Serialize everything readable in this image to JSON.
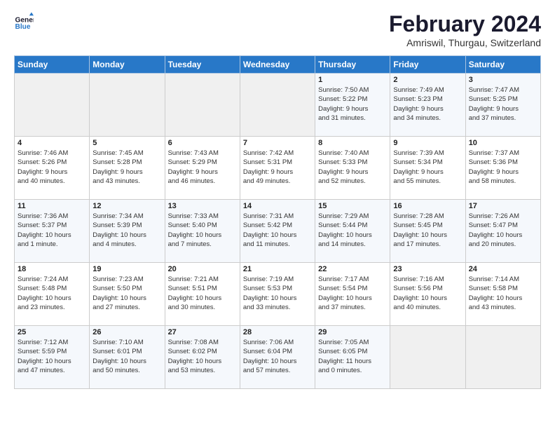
{
  "header": {
    "logo_line1": "General",
    "logo_line2": "Blue",
    "month_title": "February 2024",
    "subtitle": "Amriswil, Thurgau, Switzerland"
  },
  "days_of_week": [
    "Sunday",
    "Monday",
    "Tuesday",
    "Wednesday",
    "Thursday",
    "Friday",
    "Saturday"
  ],
  "weeks": [
    [
      {
        "num": "",
        "info": ""
      },
      {
        "num": "",
        "info": ""
      },
      {
        "num": "",
        "info": ""
      },
      {
        "num": "",
        "info": ""
      },
      {
        "num": "1",
        "info": "Sunrise: 7:50 AM\nSunset: 5:22 PM\nDaylight: 9 hours\nand 31 minutes."
      },
      {
        "num": "2",
        "info": "Sunrise: 7:49 AM\nSunset: 5:23 PM\nDaylight: 9 hours\nand 34 minutes."
      },
      {
        "num": "3",
        "info": "Sunrise: 7:47 AM\nSunset: 5:25 PM\nDaylight: 9 hours\nand 37 minutes."
      }
    ],
    [
      {
        "num": "4",
        "info": "Sunrise: 7:46 AM\nSunset: 5:26 PM\nDaylight: 9 hours\nand 40 minutes."
      },
      {
        "num": "5",
        "info": "Sunrise: 7:45 AM\nSunset: 5:28 PM\nDaylight: 9 hours\nand 43 minutes."
      },
      {
        "num": "6",
        "info": "Sunrise: 7:43 AM\nSunset: 5:29 PM\nDaylight: 9 hours\nand 46 minutes."
      },
      {
        "num": "7",
        "info": "Sunrise: 7:42 AM\nSunset: 5:31 PM\nDaylight: 9 hours\nand 49 minutes."
      },
      {
        "num": "8",
        "info": "Sunrise: 7:40 AM\nSunset: 5:33 PM\nDaylight: 9 hours\nand 52 minutes."
      },
      {
        "num": "9",
        "info": "Sunrise: 7:39 AM\nSunset: 5:34 PM\nDaylight: 9 hours\nand 55 minutes."
      },
      {
        "num": "10",
        "info": "Sunrise: 7:37 AM\nSunset: 5:36 PM\nDaylight: 9 hours\nand 58 minutes."
      }
    ],
    [
      {
        "num": "11",
        "info": "Sunrise: 7:36 AM\nSunset: 5:37 PM\nDaylight: 10 hours\nand 1 minute."
      },
      {
        "num": "12",
        "info": "Sunrise: 7:34 AM\nSunset: 5:39 PM\nDaylight: 10 hours\nand 4 minutes."
      },
      {
        "num": "13",
        "info": "Sunrise: 7:33 AM\nSunset: 5:40 PM\nDaylight: 10 hours\nand 7 minutes."
      },
      {
        "num": "14",
        "info": "Sunrise: 7:31 AM\nSunset: 5:42 PM\nDaylight: 10 hours\nand 11 minutes."
      },
      {
        "num": "15",
        "info": "Sunrise: 7:29 AM\nSunset: 5:44 PM\nDaylight: 10 hours\nand 14 minutes."
      },
      {
        "num": "16",
        "info": "Sunrise: 7:28 AM\nSunset: 5:45 PM\nDaylight: 10 hours\nand 17 minutes."
      },
      {
        "num": "17",
        "info": "Sunrise: 7:26 AM\nSunset: 5:47 PM\nDaylight: 10 hours\nand 20 minutes."
      }
    ],
    [
      {
        "num": "18",
        "info": "Sunrise: 7:24 AM\nSunset: 5:48 PM\nDaylight: 10 hours\nand 23 minutes."
      },
      {
        "num": "19",
        "info": "Sunrise: 7:23 AM\nSunset: 5:50 PM\nDaylight: 10 hours\nand 27 minutes."
      },
      {
        "num": "20",
        "info": "Sunrise: 7:21 AM\nSunset: 5:51 PM\nDaylight: 10 hours\nand 30 minutes."
      },
      {
        "num": "21",
        "info": "Sunrise: 7:19 AM\nSunset: 5:53 PM\nDaylight: 10 hours\nand 33 minutes."
      },
      {
        "num": "22",
        "info": "Sunrise: 7:17 AM\nSunset: 5:54 PM\nDaylight: 10 hours\nand 37 minutes."
      },
      {
        "num": "23",
        "info": "Sunrise: 7:16 AM\nSunset: 5:56 PM\nDaylight: 10 hours\nand 40 minutes."
      },
      {
        "num": "24",
        "info": "Sunrise: 7:14 AM\nSunset: 5:58 PM\nDaylight: 10 hours\nand 43 minutes."
      }
    ],
    [
      {
        "num": "25",
        "info": "Sunrise: 7:12 AM\nSunset: 5:59 PM\nDaylight: 10 hours\nand 47 minutes."
      },
      {
        "num": "26",
        "info": "Sunrise: 7:10 AM\nSunset: 6:01 PM\nDaylight: 10 hours\nand 50 minutes."
      },
      {
        "num": "27",
        "info": "Sunrise: 7:08 AM\nSunset: 6:02 PM\nDaylight: 10 hours\nand 53 minutes."
      },
      {
        "num": "28",
        "info": "Sunrise: 7:06 AM\nSunset: 6:04 PM\nDaylight: 10 hours\nand 57 minutes."
      },
      {
        "num": "29",
        "info": "Sunrise: 7:05 AM\nSunset: 6:05 PM\nDaylight: 11 hours\nand 0 minutes."
      },
      {
        "num": "",
        "info": ""
      },
      {
        "num": "",
        "info": ""
      }
    ]
  ]
}
